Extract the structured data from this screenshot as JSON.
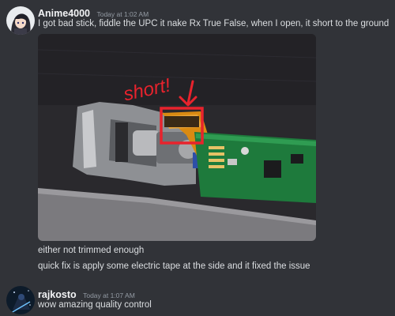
{
  "messages": [
    {
      "username": "Anime4000",
      "timestamp": "Today at 1:02 AM",
      "text": "I got bad stick, fiddle the UPC it nake Rx True False, when I open, it short to the ground",
      "attachment": {
        "annotation_text": "short!",
        "annotation_color": "#e8232d"
      },
      "followups": [
        "either not trimmed enough",
        "quick fix is apply some electric tape at the side and it fixed the issue"
      ]
    },
    {
      "username": "rajkosto",
      "timestamp": "Today at 1:07 AM",
      "text": "wow amazing quality control"
    }
  ],
  "colors": {
    "background": "#313338",
    "username": "#f2f3f5",
    "timestamp": "#949ba4",
    "text": "#dbdee1"
  }
}
